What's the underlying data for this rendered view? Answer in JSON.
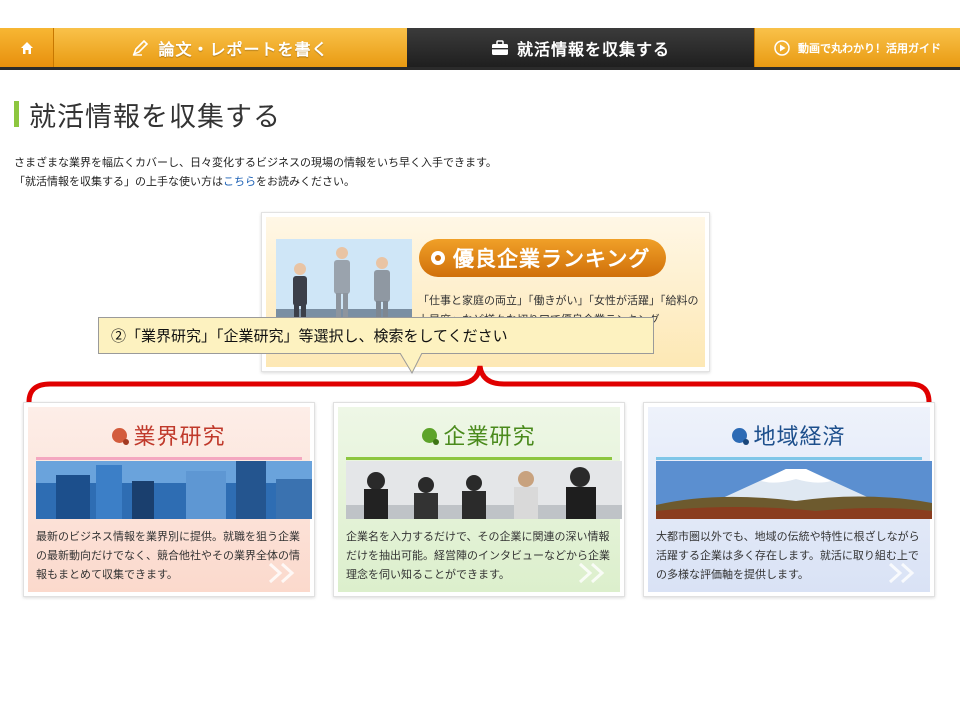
{
  "nav": {
    "write_label": "論文・レポートを書く",
    "collect_label": "就活情報を収集する",
    "guide_label": "動画で丸わかり！活用ガイド"
  },
  "page": {
    "title": "就活情報を収集する",
    "desc_line1": "さまざまな業界を幅広くカバーし、日々変化するビジネスの現場の情報をいち早く入手できます。",
    "desc_line2_pre": "「就活情報を収集する」の上手な使い方は",
    "desc_link": "こちら",
    "desc_line2_post": "をお読みください。"
  },
  "ranking": {
    "title": "優良企業ランキング",
    "text": "「仕事と家庭の両立」「働きがい」「女性が活躍」「給料の上昇度」など様々な切り口で優良企業ランキング"
  },
  "callout": {
    "text": "②「業界研究」「企業研究」等選択し、検索をしてください"
  },
  "categories": [
    {
      "title": "業界研究",
      "text": "最新のビジネス情報を業界別に提供。就職を狙う企業の最新動向だけでなく、競合他社やその業界全体の情報もまとめて収集できます。"
    },
    {
      "title": "企業研究",
      "text": "企業名を入力するだけで、その企業に関連の深い情報だけを抽出可能。経営陣のインタビューなどから企業理念を伺い知ることができます。"
    },
    {
      "title": "地域経済",
      "text": "大都市圏以外でも、地域の伝統や特性に根ざしながら活躍する企業は多く存在します。就活に取り組む上での多様な評価軸を提供します。"
    }
  ],
  "colors": {
    "nav_orange": "#f0a020",
    "nav_dark": "#2b2b2b",
    "title_accent": "#8dc63f",
    "brace_red": "#e00000",
    "link_blue": "#1a5fb4"
  }
}
